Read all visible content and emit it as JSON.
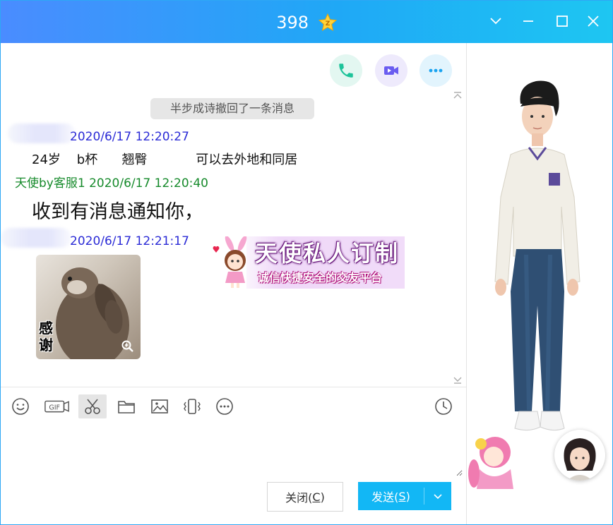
{
  "window": {
    "title": "398",
    "badge_icon": "svip-star-badge",
    "accent": "#12b7f5"
  },
  "chat": {
    "recall_notice": "半步成诗撤回了一条消息",
    "messages": [
      {
        "sender": "",
        "timestamp": "2020/6/17 12:20:27",
        "text": "24岁    b杯      翘臀            可以去外地和同居",
        "color": "#2b2bd6"
      },
      {
        "sender": "天使by客服1",
        "timestamp": "2020/6/17 12:20:40",
        "text": "收到有消息通知你，",
        "color": "#168a2b"
      },
      {
        "sender": "",
        "timestamp": "2020/6/17 12:21:17",
        "sticker_text": "感谢",
        "color": "#2b2bd6"
      }
    ],
    "banner": {
      "title": "天使私人订制",
      "subtitle": "诚信快捷安全的交友平台"
    }
  },
  "toolbar": {
    "items": [
      "emoji-icon",
      "gif-icon",
      "scissors-icon",
      "folder-icon",
      "image-icon",
      "shake-icon",
      "more-icon",
      "clock-icon"
    ],
    "gif_label": "GIF"
  },
  "buttons": {
    "close_label": "关闭(",
    "close_key": "C",
    "close_end": ")",
    "send_label": "发送(",
    "send_key": "S",
    "send_end": ")"
  }
}
